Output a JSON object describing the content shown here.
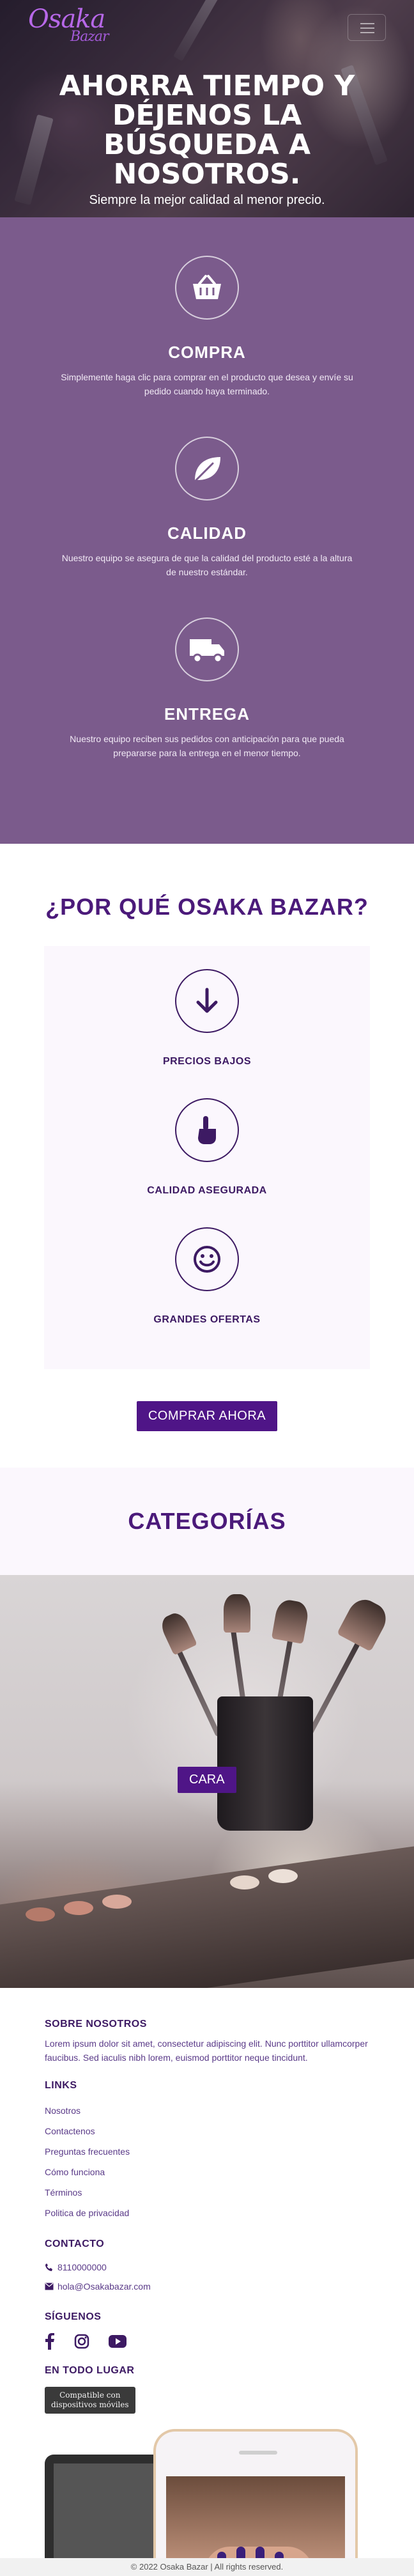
{
  "brand": {
    "logo_main": "Osaka",
    "logo_sub": "Bazar",
    "primary_color": "#4f1587",
    "features_bg": "#7b5b8c"
  },
  "hero": {
    "title": "AHORRA TIEMPO Y DÉJENOS LA BÚSQUEDA A NOSOTROS.",
    "subtitle": "Siempre la mejor calidad al menor precio."
  },
  "features": [
    {
      "icon": "basket-icon",
      "title": "COMPRA",
      "description": "Simplemente haga clic para comprar en el producto que desea y envíe su pedido cuando haya terminado."
    },
    {
      "icon": "leaf-icon",
      "title": "CALIDAD",
      "description": "Nuestro equipo se asegura de que la calidad del producto esté a la altura de nuestro estándar."
    },
    {
      "icon": "truck-icon",
      "title": "ENTREGA",
      "description": "Nuestro equipo reciben sus pedidos con anticipación para que pueda prepararse para la entrega en el menor tiempo."
    }
  ],
  "why": {
    "title": "¿POR QUÉ OSAKA BAZAR?",
    "items": [
      {
        "icon": "arrow-down-circle-icon",
        "label": "PRECIOS BAJOS"
      },
      {
        "icon": "hand-pointer-icon",
        "label": "CALIDAD ASEGURADA"
      },
      {
        "icon": "smile-face-icon",
        "label": "GRANDES OFERTAS"
      }
    ],
    "button_label": "COMPRAR AHORA"
  },
  "categories": {
    "title": "CATEGORÍAS",
    "button_label": "CARA"
  },
  "footer": {
    "about_title": "SOBRE NOSOTROS",
    "about_text": "Lorem ipsum dolor sit amet, consectetur adipiscing elit. Nunc porttitor ullamcorper faucibus. Sed iaculis nibh lorem, euismod porttitor neque tincidunt.",
    "links_title": "LINKS",
    "links": [
      "Nosotros",
      "Contactenos",
      "Preguntas frecuentes",
      "Cómo funciona",
      "Términos",
      "Politica de privacidad"
    ],
    "contact_title": "CONTACTO",
    "phone": "8110000000",
    "email": "hola@Osakabazar.com",
    "follow_title": "SÍGUENOS",
    "social": [
      "facebook-icon",
      "instagram-icon",
      "youtube-icon"
    ],
    "everywhere_title": "EN TODO LUGAR",
    "badge_line1": "Compatible con",
    "badge_line2": "dispositivos móviles",
    "copyright": "© 2022 Osaka Bazar | All rights reserved."
  }
}
